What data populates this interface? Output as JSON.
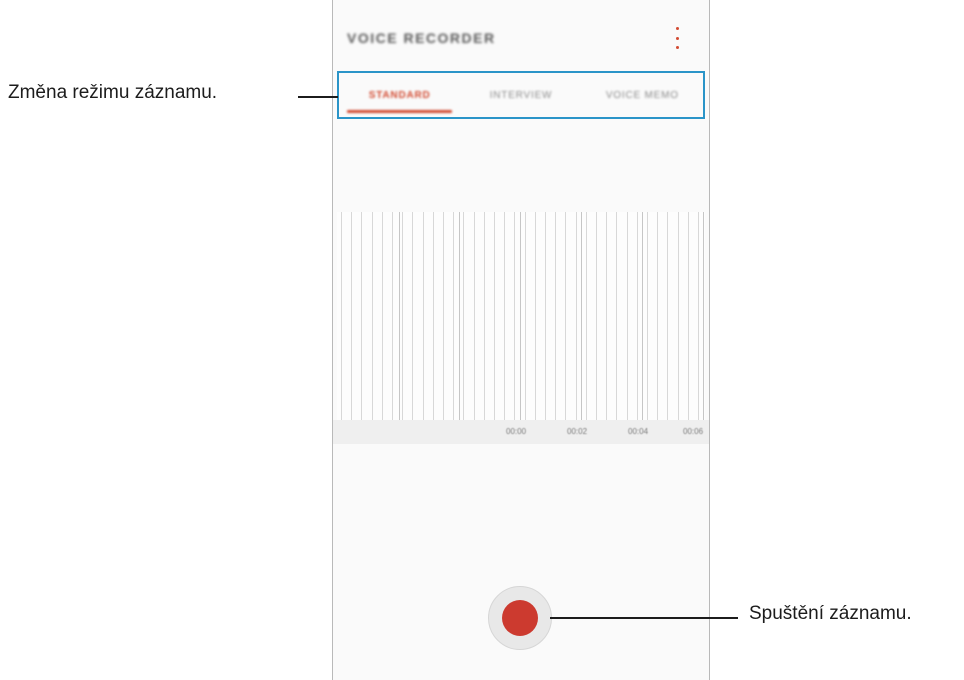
{
  "app": {
    "title": "VOICE RECORDER",
    "menu_icon": "more-vert-icon",
    "tabs": [
      {
        "label": "STANDARD",
        "active": true
      },
      {
        "label": "INTERVIEW",
        "active": false
      },
      {
        "label": "VOICE MEMO",
        "active": false
      }
    ],
    "timeline": [
      "00:00",
      "00:02",
      "00:04",
      "00:06"
    ],
    "record_icon": "record-icon"
  },
  "callouts": {
    "mode": "Změna režimu záznamu.",
    "record": "Spuštění záznamu."
  },
  "colors": {
    "accent": "#d24b32",
    "highlight_box": "#2a94c8",
    "record": "#cc3a2f"
  }
}
